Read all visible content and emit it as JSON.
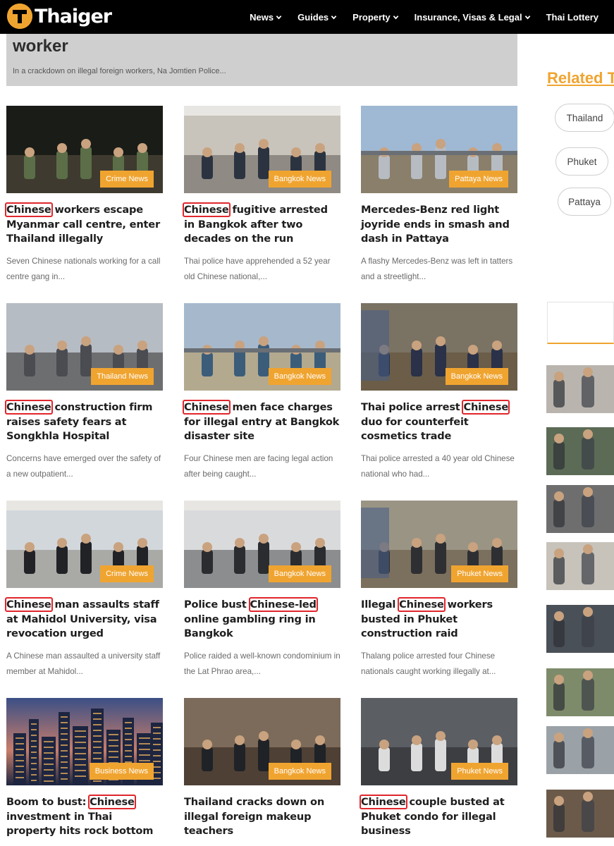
{
  "brand": {
    "logo_text": "Thaiger",
    "accent": "#f0a430"
  },
  "nav": {
    "items": [
      {
        "label": "News",
        "has_dropdown": true
      },
      {
        "label": "Guides",
        "has_dropdown": true
      },
      {
        "label": "Property",
        "has_dropdown": true
      },
      {
        "label": "Insurance, Visas & Legal",
        "has_dropdown": true
      },
      {
        "label": "Thai Lottery",
        "has_dropdown": false
      }
    ]
  },
  "hero": {
    "title_fragment": "worker",
    "excerpt": "In a crackdown on illegal foreign workers, Na Jomtien Police..."
  },
  "highlight": {
    "color": "#e0262c"
  },
  "articles": [
    {
      "category": "Crime News",
      "title_before": "",
      "title_highlight": "Chinese",
      "title_after": " workers escape Myanmar call centre, enter Thailand illegally",
      "excerpt": "Seven Chinese nationals working for a call centre gang in..."
    },
    {
      "category": "Bangkok News",
      "title_before": "",
      "title_highlight": "Chinese",
      "title_after": " fugitive arrested in Bangkok after two decades on the run",
      "excerpt": "Thai police have apprehended a 52 year old Chinese national,..."
    },
    {
      "category": "Pattaya News",
      "title_before": "Mercedes-Benz red light joyride ends in smash and dash in Pattaya",
      "title_highlight": "",
      "title_after": "",
      "excerpt": "A flashy Mercedes-Benz was left in tatters and a streetlight..."
    },
    {
      "category": "Thailand News",
      "title_before": "",
      "title_highlight": "Chinese",
      "title_after": " construction firm raises safety fears at Songkhla Hospital",
      "excerpt": "Concerns have emerged over the safety of a new outpatient..."
    },
    {
      "category": "Bangkok News",
      "title_before": "",
      "title_highlight": "Chinese",
      "title_after": " men face charges for illegal entry at Bangkok disaster site",
      "excerpt": "Four Chinese men are facing legal action after being caught..."
    },
    {
      "category": "Bangkok News",
      "title_before": "Thai police arrest ",
      "title_highlight": "Chinese",
      "title_after": " duo for counterfeit cosmetics trade",
      "excerpt": "Thai police arrested a 40 year old Chinese national who had..."
    },
    {
      "category": "Crime News",
      "title_before": "",
      "title_highlight": "Chinese",
      "title_after": " man assaults staff at Mahidol University, visa revocation urged",
      "excerpt": "A Chinese man assaulted a university staff member at Mahidol..."
    },
    {
      "category": "Bangkok News",
      "title_before": "Police bust ",
      "title_highlight": "Chinese-led",
      "title_after": " online gambling ring in Bangkok",
      "excerpt": "Police raided a well-known condominium in the Lat Phrao area,..."
    },
    {
      "category": "Phuket News",
      "title_before": "Illegal ",
      "title_highlight": "Chinese",
      "title_after": " workers busted in Phuket construction raid",
      "excerpt": "Thalang police arrested four Chinese nationals caught working illegally at..."
    },
    {
      "category": "Business News",
      "title_before": "Boom to bust: ",
      "title_highlight": "Chinese",
      "title_after": " investment in Thai property hits rock bottom",
      "excerpt": ""
    },
    {
      "category": "Bangkok News",
      "title_before": "Thailand cracks down on illegal foreign makeup teachers",
      "title_highlight": "",
      "title_after": "",
      "excerpt": ""
    },
    {
      "category": "Phuket News",
      "title_before": "",
      "title_highlight": "Chinese",
      "title_after": " couple busted at Phuket condo for illegal business",
      "excerpt": ""
    }
  ],
  "sidebar": {
    "related_heading": "Related T",
    "tags": [
      "Thailand",
      "Phuket",
      "Pattaya"
    ]
  }
}
